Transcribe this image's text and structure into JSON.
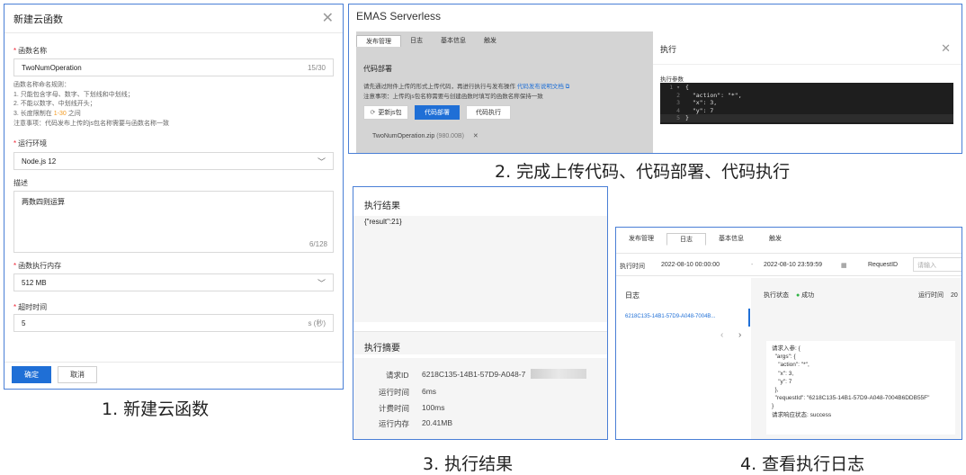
{
  "panel1": {
    "title": "新建云函数",
    "name_label": "函数名称",
    "name_value": "TwoNumOperation",
    "name_count": "15/30",
    "rules": [
      "函数名称命名规则：",
      "1. 只能包含字母、数字、下划线和中划线；",
      "2. 不能以数字、中划线开头；"
    ],
    "rule3_prefix": "3. 长度限制在 ",
    "rule3_highlight": "1-30",
    "rule3_suffix": " 之间",
    "note": "注意事项：代码发布上传的js包名称需要与函数名称一致",
    "runtime_label": "运行环境",
    "runtime_value": "Node.js 12",
    "desc_label": "描述",
    "desc_value": "两数四则运算",
    "desc_count": "6/128",
    "memory_label": "函数执行内存",
    "memory_value": "512 MB",
    "timeout_label": "超时时间",
    "timeout_value": "5",
    "timeout_unit": "s (秒)",
    "ok": "确定",
    "cancel": "取消"
  },
  "caption1": "1. 新建云函数",
  "panel2": {
    "brand": "EMAS Serverless",
    "tabs": [
      "发布管理",
      "日志",
      "基本信息",
      "触发"
    ],
    "section": "代码部署",
    "line1": "请先通过附件上传的形式上传代码，再进行执行与发布操作",
    "doc_link": "代码发布说明文档",
    "line2": "注意事项：上传的js包名称需要与创建函数时填写的函数名称保持一致",
    "btn_upload": "更新js包",
    "btn_deploy": "代码部署",
    "btn_exec": "代码执行",
    "file": "TwoNumOperation.zip",
    "file_size": "(980.00B)",
    "exec_title": "执行",
    "params_label": "执行参数",
    "code": [
      "{",
      "  \"action\": \"*\",",
      "  \"x\": 3,",
      "  \"y\": 7",
      "}"
    ]
  },
  "caption2": "2. 完成上传代码、代码部署、代码执行",
  "panel3": {
    "result_title": "执行结果",
    "result_value": "{\"result\":21}",
    "summary_title": "执行摘要",
    "rows": [
      {
        "k": "请求ID",
        "v": "6218C135-14B1-57D9-A048-7"
      },
      {
        "k": "运行时间",
        "v": "6ms"
      },
      {
        "k": "计费时间",
        "v": "100ms"
      },
      {
        "k": "运行内存",
        "v": "20.41MB"
      }
    ]
  },
  "caption3": "3. 执行结果",
  "panel4": {
    "tabs": [
      "发布管理",
      "日志",
      "基本信息",
      "触发"
    ],
    "time_label": "执行时间",
    "start": "2022-08-10 00:00:00",
    "end": "2022-08-10 23:59:59",
    "reqid_label": "RequestID",
    "reqid_placeholder": "请输入",
    "log_title": "日志",
    "log_item": "6218C135-14B1-57D9-A048-7004B...",
    "status_label": "执行状态",
    "status_value": "成功",
    "runtime_label": "运行时间",
    "runtime_value": "20",
    "log_body": "请求入参: {\n  \"args\": {\n    \"action\": \"*\",\n    \"x\": 3,\n    \"y\": 7\n  },\n  \"requestId\": \"6218C135-14B1-57D9-A048-7004B6DDB55F\"\n}\n请求响应状态: success"
  },
  "caption4": "4. 查看执行日志",
  "colors": {
    "primary": "#1f6fd6",
    "frame": "#4a7fd6",
    "highlight": "#f39a1f",
    "success": "#2fb344"
  }
}
